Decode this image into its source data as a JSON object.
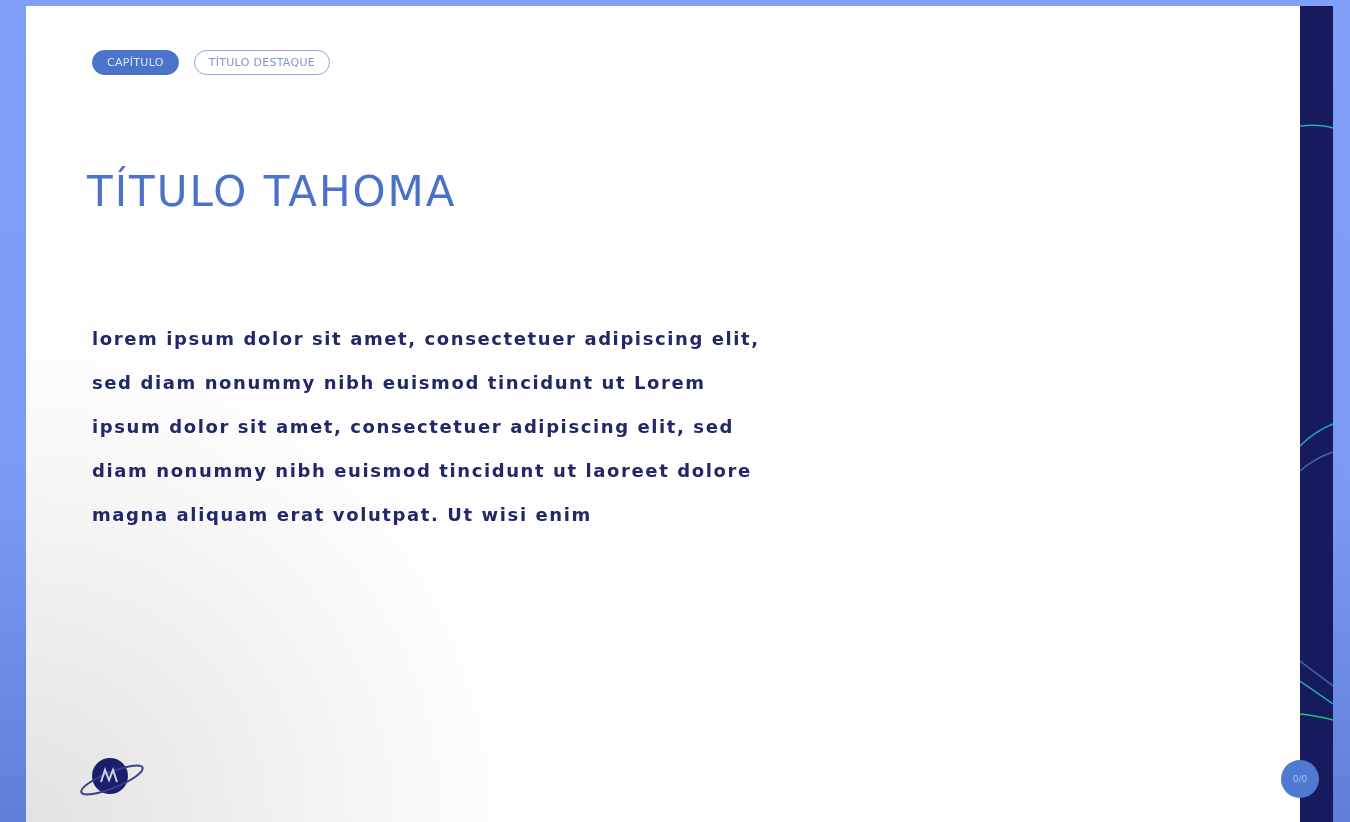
{
  "tags": [
    {
      "label": "CAPÍTULO",
      "kind": "filled"
    },
    {
      "label": "TÍTULO DESTAQUE",
      "kind": "outline"
    }
  ],
  "title": "TÍTULO TAHOMA",
  "body": [
    "lorem ipsum dolor sit amet, consectetuer adipiscing elit,",
    "sed diam nonummy nibh euismod tincidunt ut Lorem",
    "ipsum dolor sit amet, consectetuer adipiscing elit, sed",
    "diam nonummy nibh euismod tincidunt ut laoreet dolore",
    "magna aliquam erat volutpat. Ut wisi enim"
  ],
  "page_badge": "0/0"
}
